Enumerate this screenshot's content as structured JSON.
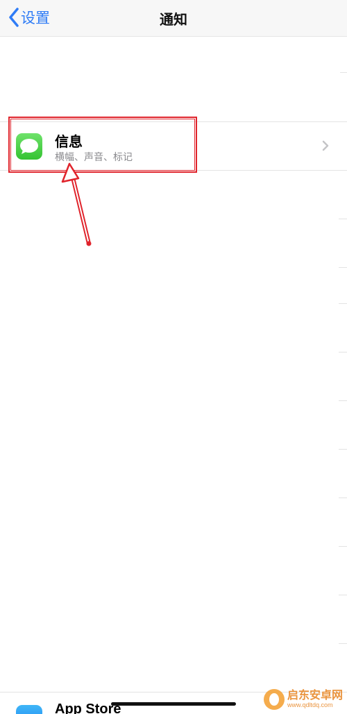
{
  "navbar": {
    "back_label": "设置",
    "title": "通知"
  },
  "messages_row": {
    "title": "信息",
    "subtitle": "横幅、声音、标记"
  },
  "next_row": {
    "title": "App Store"
  },
  "watermark": {
    "name": "启东安卓网",
    "url": "www.qdltdq.com"
  },
  "colors": {
    "accent": "#2f7cf6",
    "highlight": "#e0242c",
    "messages_icon": "#4cd964"
  },
  "icons": [
    "chevron-left-icon",
    "messages-icon",
    "chevron-right-icon",
    "app-store-icon"
  ]
}
